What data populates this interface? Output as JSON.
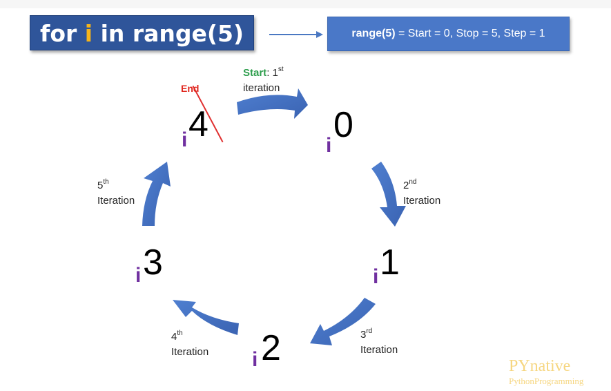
{
  "header": {
    "code_for": "for ",
    "code_var": "i",
    "code_rest": " in range(5)",
    "range_call": "range(5)",
    "range_desc": " = Start = 0, Stop = 5, Step = 1"
  },
  "numbers": {
    "n0": "0",
    "n1": "1",
    "n2": "2",
    "n3": "3",
    "n4": "4",
    "var": "i"
  },
  "labels": {
    "start_word": "Start",
    "start_rest": ": 1",
    "start_sup": "st",
    "start_line2": "iteration",
    "end": "End",
    "second_num": "2",
    "second_sup": "nd",
    "second_word": "Iteration",
    "third_num": "3",
    "third_sup": "rd",
    "third_word": "Iteration",
    "fourth_num": "4",
    "fourth_sup": "th",
    "fourth_word": "Iteration",
    "fifth_num": "5",
    "fifth_sup": "th",
    "fifth_word": "Iteration"
  },
  "watermark": {
    "brand": "PYnative",
    "tagline": "PythonProgramming"
  },
  "colors": {
    "code_box": "#2f559a",
    "range_box": "#4a78c8",
    "arrow": "#4472c4",
    "var_yellow": "#f5b41a",
    "var_purple": "#7030a0",
    "start_green": "#2e9e4d",
    "end_red": "#e0261d"
  }
}
